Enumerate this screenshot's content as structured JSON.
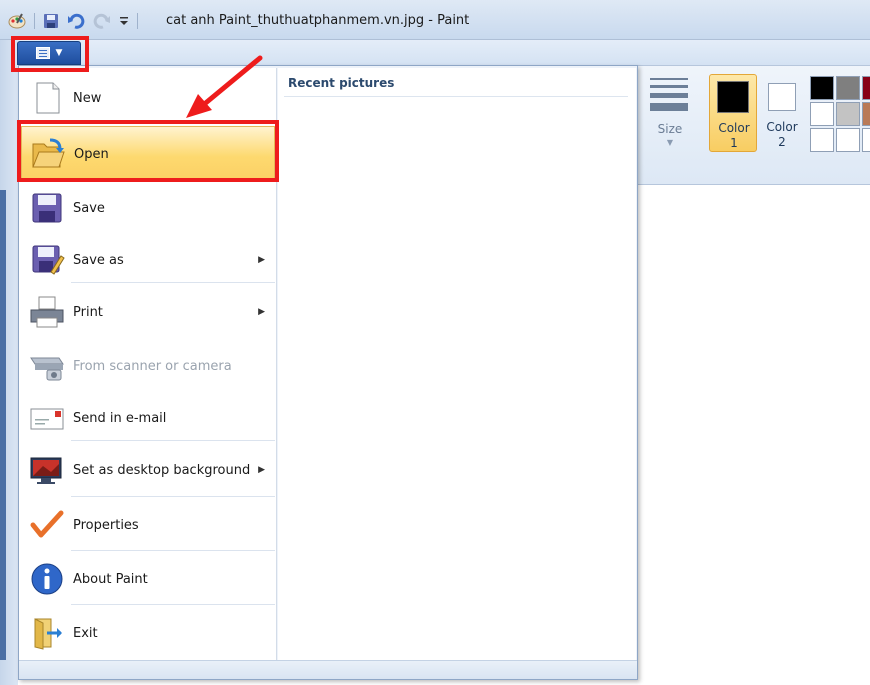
{
  "window": {
    "title": "cat anh Paint_thuthuatphanmem.vn.jpg - Paint"
  },
  "ribbon": {
    "size_label": "Size",
    "color1_label": "Color\n1",
    "color2_label": "Color\n2",
    "color1_line1": "Color",
    "color1_line2": "1",
    "color2_line1": "Color",
    "color2_line2": "2",
    "palette_colors": [
      "#000000",
      "#7f7f7f",
      "#880015",
      "#ffffff",
      "#c3c3c3",
      "#b97a57",
      "#ffffff",
      "#ffffff",
      "#ffffff"
    ]
  },
  "app_menu": {
    "recent_title": "Recent pictures",
    "items": [
      {
        "label": "New",
        "icon": "new-file-icon"
      },
      {
        "label": "Open",
        "icon": "open-folder-icon"
      },
      {
        "label": "Save",
        "icon": "save-disk-icon"
      },
      {
        "label": "Save as",
        "icon": "save-as-icon"
      },
      {
        "label": "Print",
        "icon": "printer-icon"
      },
      {
        "label": "From scanner or camera",
        "icon": "scanner-icon"
      },
      {
        "label": "Send in e-mail",
        "icon": "email-icon"
      },
      {
        "label": "Set as desktop background",
        "icon": "desktop-icon"
      },
      {
        "label": "Properties",
        "icon": "checkmark-icon"
      },
      {
        "label": "About Paint",
        "icon": "info-icon"
      },
      {
        "label": "Exit",
        "icon": "exit-icon"
      }
    ]
  },
  "colors": {
    "highlight": "#ee1c1c",
    "hover": "#fdd96f",
    "accent": "#1f4e9e"
  }
}
